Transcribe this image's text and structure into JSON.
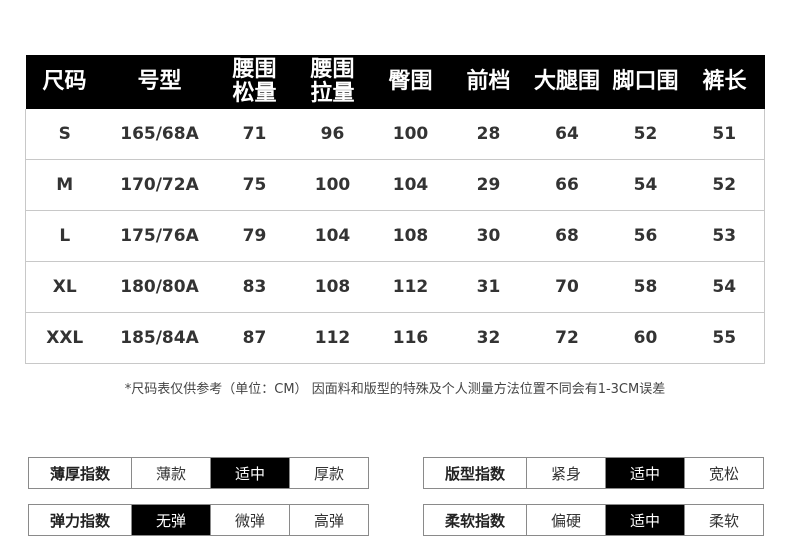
{
  "size_table": {
    "headers": [
      "尺码",
      "号型",
      "腰围\n松量",
      "腰围\n拉量",
      "臀围",
      "前档",
      "大腿围",
      "脚口围",
      "裤长"
    ],
    "rows": [
      [
        "S",
        "165/68A",
        "71",
        "96",
        "100",
        "28",
        "64",
        "52",
        "51"
      ],
      [
        "M",
        "170/72A",
        "75",
        "100",
        "104",
        "29",
        "66",
        "54",
        "52"
      ],
      [
        "L",
        "175/76A",
        "79",
        "104",
        "108",
        "30",
        "68",
        "56",
        "53"
      ],
      [
        "XL",
        "180/80A",
        "83",
        "108",
        "112",
        "31",
        "70",
        "58",
        "54"
      ],
      [
        "XXL",
        "185/84A",
        "87",
        "112",
        "116",
        "32",
        "72",
        "60",
        "55"
      ]
    ]
  },
  "note": "*尺码表仅供参考（单位：CM） 因面料和版型的特殊及个人测量方法位置不同会有1-3CM误差",
  "indices": [
    {
      "label": "薄厚指数",
      "options": [
        "薄款",
        "适中",
        "厚款"
      ],
      "selected": 1
    },
    {
      "label": "版型指数",
      "options": [
        "紧身",
        "适中",
        "宽松"
      ],
      "selected": 1
    },
    {
      "label": "弹力指数",
      "options": [
        "无弹",
        "微弹",
        "高弹"
      ],
      "selected": 0
    },
    {
      "label": "柔软指数",
      "options": [
        "偏硬",
        "适中",
        "柔软"
      ],
      "selected": 1
    }
  ],
  "colors": {
    "header_bg": "#000000",
    "selected_bg": "#000000",
    "border": "#8a8a8a"
  }
}
